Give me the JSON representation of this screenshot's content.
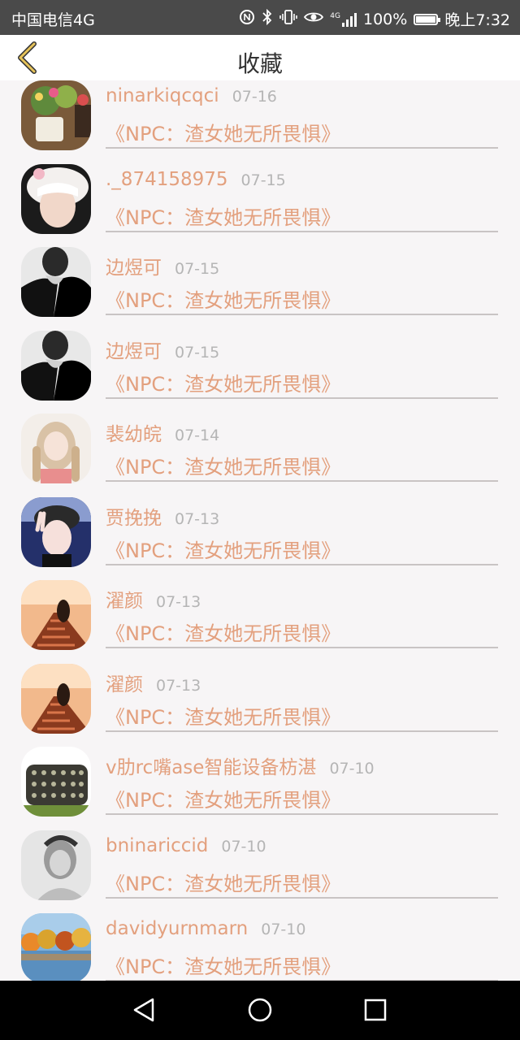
{
  "status_bar": {
    "carrier": "中国电信4G",
    "network": "4G",
    "battery": "100%",
    "time": "晚上7:32",
    "icons": [
      "nfc-icon",
      "bluetooth-icon",
      "vibrate-icon",
      "eye-icon",
      "signal-icon",
      "battery-icon"
    ]
  },
  "header": {
    "title": "收藏",
    "back_icon": "chevron-left-icon"
  },
  "colors": {
    "accent": "#e3a07e",
    "back_icon": "#e6c35a",
    "date": "#b5b5b5",
    "divider": "#c9c4c4"
  },
  "items": [
    {
      "name": "ninarkiqcqci",
      "date": "07-16",
      "work": "《NPC：渣女她无所畏惧》",
      "avatar": "avatar-flowers"
    },
    {
      "name": "._874158975",
      "date": "07-15",
      "work": "《NPC：渣女她无所畏惧》",
      "avatar": "avatar-girl-hat"
    },
    {
      "name": "边煜可",
      "date": "07-15",
      "work": "《NPC：渣女她无所畏惧》",
      "avatar": "avatar-man-dark"
    },
    {
      "name": "边煜可",
      "date": "07-15",
      "work": "《NPC：渣女她无所畏惧》",
      "avatar": "avatar-man-dark"
    },
    {
      "name": "裴幼皖",
      "date": "07-14",
      "work": "《NPC：渣女她无所畏惧》",
      "avatar": "avatar-girl-braids"
    },
    {
      "name": "贾挽挽",
      "date": "07-13",
      "work": "《NPC：渣女她无所畏惧》",
      "avatar": "avatar-girl-peace"
    },
    {
      "name": "濯颜",
      "date": "07-13",
      "work": "《NPC：渣女她无所畏惧》",
      "avatar": "avatar-sunset-rails"
    },
    {
      "name": "濯颜",
      "date": "07-13",
      "work": "《NPC：渣女她无所畏惧》",
      "avatar": "avatar-sunset-rails"
    },
    {
      "name": "v肋rc嘴ase智能设备枋湛",
      "date": "07-10",
      "work": "《NPC：渣女她无所畏惧》",
      "avatar": "avatar-studded"
    },
    {
      "name": "bninariccid",
      "date": "07-10",
      "work": "《NPC：渣女她无所畏惧》",
      "avatar": "avatar-bw-portrait"
    },
    {
      "name": "davidyurnmarn",
      "date": "07-10",
      "work": "《NPC：渣女她无所畏惧》",
      "avatar": "avatar-autumn-lake"
    }
  ],
  "nav_bar": {
    "back_icon": "triangle-back-icon",
    "home_icon": "circle-home-icon",
    "recents_icon": "square-recents-icon"
  }
}
